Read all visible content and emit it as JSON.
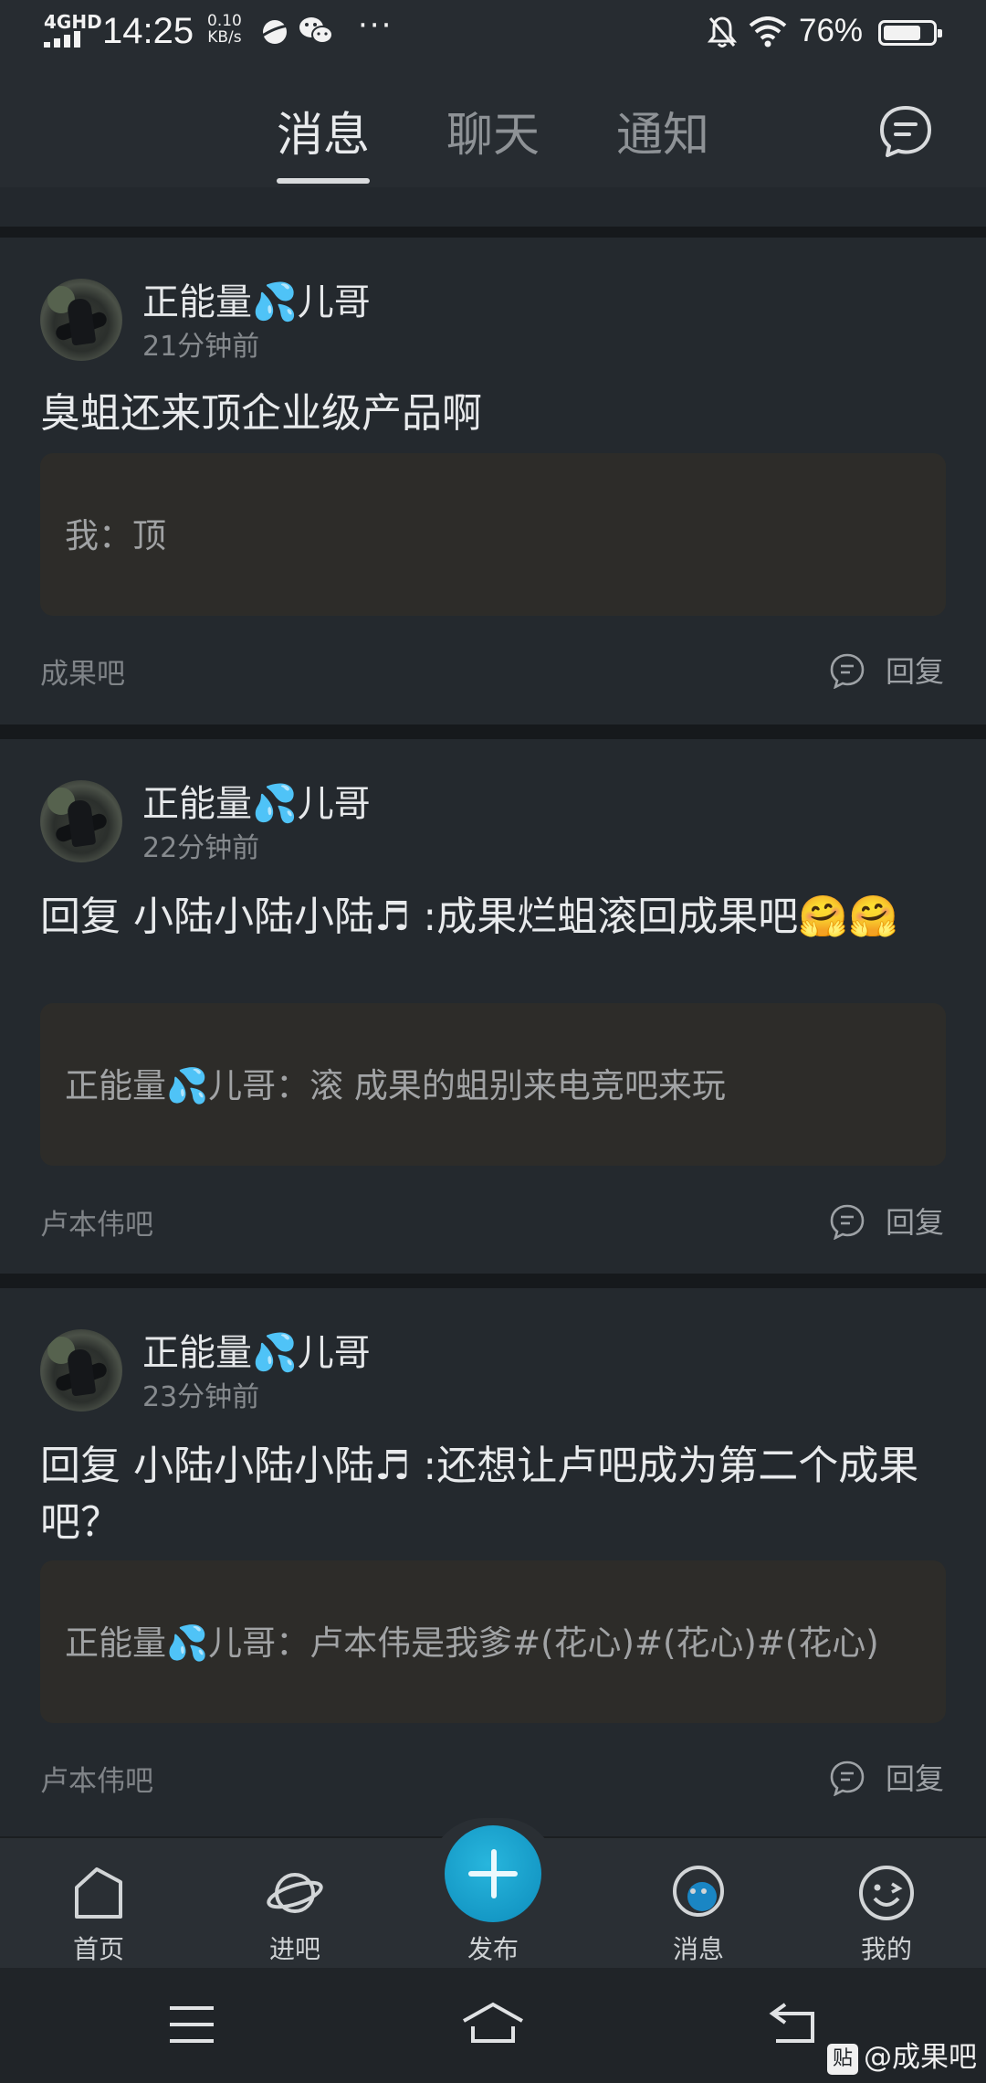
{
  "status_bar": {
    "network": "4GHD",
    "time": "14:25",
    "speed_value": "0.10",
    "speed_unit": "KB/s",
    "more": "···",
    "battery_text": "76%",
    "battery_level": 0.76,
    "icons": [
      "signal-icon",
      "planet-icon",
      "wechat-icon",
      "mute-bell-icon",
      "wifi-icon",
      "battery-icon"
    ]
  },
  "header": {
    "tabs": [
      {
        "label": "消息",
        "active": true
      },
      {
        "label": "聊天",
        "active": false
      },
      {
        "label": "通知",
        "active": false
      }
    ],
    "right_icon": "chat-bubble-icon"
  },
  "messages": [
    {
      "user": "正能量💦儿哥",
      "time": "21分钟前",
      "content": "臭蛆还来顶企业级产品啊",
      "quote": "我：顶",
      "forum": "成果吧",
      "reply_label": "回复"
    },
    {
      "user": "正能量💦儿哥",
      "time": "22分钟前",
      "content": "回复 小陆小陆小陆♬ :成果烂蛆滚回成果吧🤗🤗",
      "quote": "正能量💦儿哥：滚 成果的蛆别来电竞吧来玩",
      "forum": "卢本伟吧",
      "reply_label": "回复"
    },
    {
      "user": "正能量💦儿哥",
      "time": "23分钟前",
      "content": "回复 小陆小陆小陆♬ :还想让卢吧成为第二个成果吧？",
      "quote": "正能量💦儿哥：卢本伟是我爹#(花心)#(花心)#(花心)",
      "forum": "卢本伟吧",
      "reply_label": "回复"
    }
  ],
  "bottom_nav": {
    "items": [
      {
        "label": "首页",
        "icon": "home-icon"
      },
      {
        "label": "进吧",
        "icon": "planet-icon"
      },
      {
        "label": "发布",
        "icon": "plus-icon"
      },
      {
        "label": "消息",
        "icon": "message-icon"
      },
      {
        "label": "我的",
        "icon": "smiley-icon"
      }
    ]
  },
  "system_nav": {
    "icons": [
      "menu-icon",
      "home-outline-icon",
      "back-icon"
    ]
  },
  "watermark": {
    "badge": "贴",
    "text": "@成果吧"
  },
  "colors": {
    "background": "#1b1e21",
    "card": "#24292e",
    "quote": "#2d2c29",
    "accent": "#1599c6"
  }
}
